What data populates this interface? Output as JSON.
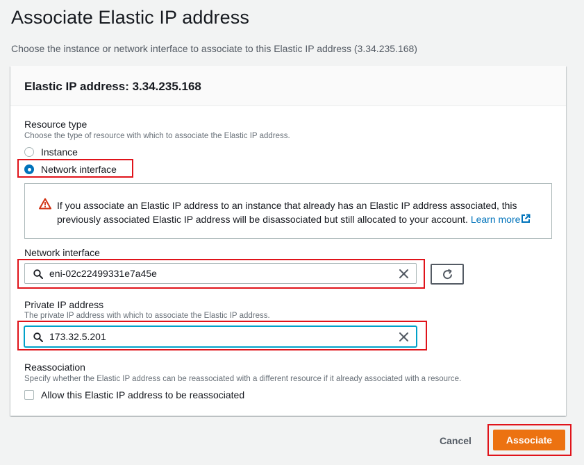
{
  "page": {
    "title": "Associate Elastic IP address",
    "description": "Choose the instance or network interface to associate to this Elastic IP address (3.34.235.168)"
  },
  "container": {
    "title": "Elastic IP address: 3.34.235.168"
  },
  "resource_type": {
    "label": "Resource type",
    "description": "Choose the type of resource with which to associate the Elastic IP address.",
    "options": [
      {
        "label": "Instance",
        "selected": false
      },
      {
        "label": "Network interface",
        "selected": true
      }
    ]
  },
  "alert": {
    "icon": "warning-icon",
    "text": "If you associate an Elastic IP address to an instance that already has an Elastic IP address associated, this previously associated Elastic IP address will be disassociated but still allocated to your account.",
    "link_text": "Learn more",
    "link_icon": "external-link-icon"
  },
  "network_interface": {
    "label": "Network interface",
    "value": "eni-02c22499331e7a45e",
    "icons": [
      "search-icon",
      "clear-icon",
      "refresh-icon"
    ]
  },
  "private_ip": {
    "label": "Private IP address",
    "description": "The private IP address with which to associate the Elastic IP address.",
    "value": "173.32.5.201",
    "icons": [
      "search-icon",
      "clear-icon"
    ]
  },
  "reassociation": {
    "label": "Reassociation",
    "description": "Specify whether the Elastic IP address can be reassociated with a different resource if it already associated with a resource.",
    "checkbox_label": "Allow this Elastic IP address to be reassociated",
    "checked": false
  },
  "actions": {
    "cancel_label": "Cancel",
    "submit_label": "Associate"
  },
  "colors": {
    "accent": "#ec7211",
    "link": "#0073bb",
    "highlight_box": "#e0131a",
    "warning": "#d13212"
  }
}
